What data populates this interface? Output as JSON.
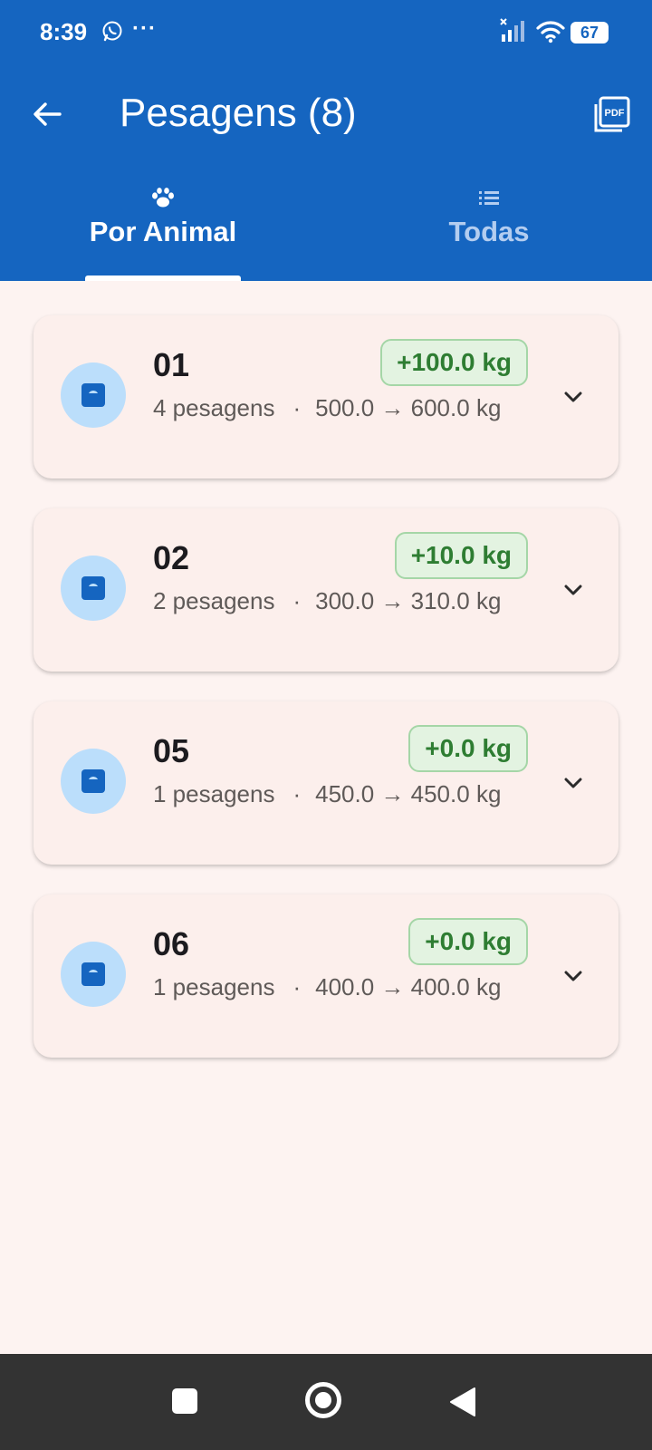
{
  "status_bar": {
    "time": "8:39",
    "more": "···",
    "battery": "67"
  },
  "app_bar": {
    "title": "Pesagens (8)"
  },
  "tabs": [
    {
      "label": "Por Animal",
      "icon": "paw-icon",
      "selected": true
    },
    {
      "label": "Todas",
      "icon": "list-icon",
      "selected": false
    }
  ],
  "animals": [
    {
      "name": "01",
      "gain": "+100.0 kg",
      "count": "4 pesagens",
      "separator": "·",
      "range": "500.0 → 600.0",
      "unit": "kg"
    },
    {
      "name": "02",
      "gain": "+10.0 kg",
      "count": "2 pesagens",
      "separator": "·",
      "range": "300.0 → 310.0",
      "unit": "kg"
    },
    {
      "name": "05",
      "gain": "+0.0 kg",
      "count": "1 pesagens",
      "separator": "·",
      "range": "450.0 → 450.0",
      "unit": "kg"
    },
    {
      "name": "06",
      "gain": "+0.0 kg",
      "count": "1 pesagens",
      "separator": "·",
      "range": "400.0 → 400.0",
      "unit": "kg"
    }
  ],
  "colors": {
    "primary": "#1565c0",
    "gain_text": "#2e7d32",
    "gain_bg": "#e3f3e1",
    "card_bg": "#fcefec",
    "avatar_bg": "#bbdefb"
  }
}
